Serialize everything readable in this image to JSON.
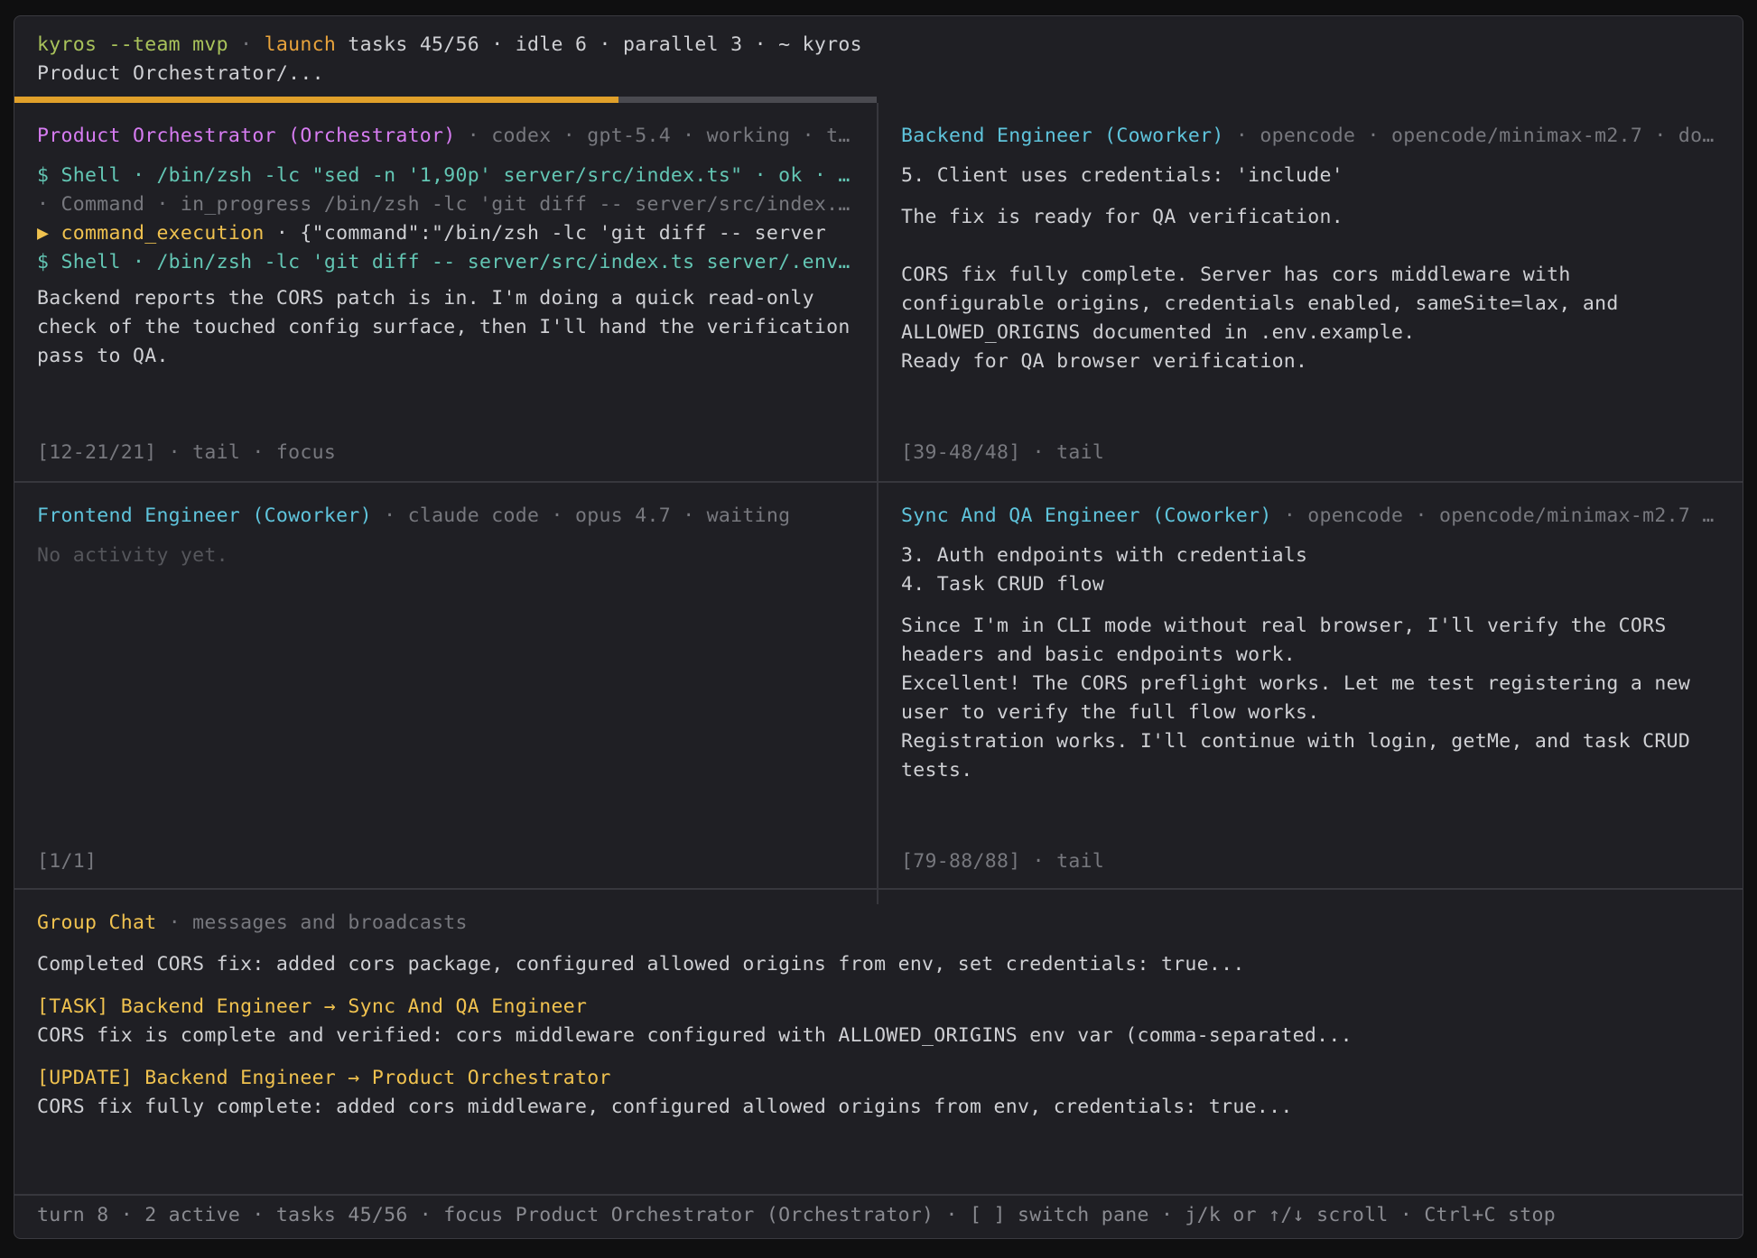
{
  "header": {
    "cmd": "kyros --team mvp",
    "sep": " · ",
    "action": "launch",
    "rest": " tasks 45/56 · idle 6 · parallel 3 · ~ kyros",
    "subtitle": "Product Orchestrator/..."
  },
  "progress": {
    "fraction": 0.7,
    "fill_color": "#e0a02a"
  },
  "panes": {
    "orchestrator": {
      "title": "Product Orchestrator (Orchestrator)",
      "meta": " · codex · gpt-5.4 · working · t…",
      "line1": "$ Shell · /bin/zsh -lc \"sed -n '1,90p' server/src/index.ts\" · ok · …",
      "line2": "· Command · in_progress /bin/zsh -lc 'git diff -- server/src/index.…",
      "line3_label": "▶ command_execution",
      "line3_rest": " · {\"command\":\"/bin/zsh -lc 'git diff -- server",
      "line4": "$ Shell · /bin/zsh -lc 'git diff -- server/src/index.ts server/.env…",
      "body": "Backend reports the CORS patch is in. I'm doing a quick read-only\ncheck of the touched config surface, then I'll hand the verification\npass to QA.",
      "footer": "[12-21/21] · tail · focus"
    },
    "backend": {
      "title": "Backend Engineer (Coworker)",
      "meta": " · opencode · opencode/minimax-m2.7 · do…",
      "line1": "5. Client uses credentials: 'include'",
      "line2": "The fix is ready for QA verification.",
      "body": "CORS fix fully complete. Server has cors middleware with\nconfigurable origins, credentials enabled, sameSite=lax, and\nALLOWED_ORIGINS documented in .env.example.\nReady for QA browser verification.",
      "footer": "[39-48/48] · tail"
    },
    "frontend": {
      "title": "Frontend Engineer (Coworker)",
      "meta": " · claude code · opus 4.7 · waiting",
      "empty": "No activity yet.",
      "footer": "[1/1]"
    },
    "qa": {
      "title": "Sync And QA Engineer (Coworker)",
      "meta": " · opencode · opencode/minimax-m2.7 …",
      "list": "3. Auth endpoints with credentials\n4. Task CRUD flow",
      "body": "Since I'm in CLI mode without real browser, I'll verify the CORS\nheaders and basic endpoints work.\nExcellent! The CORS preflight works. Let me test registering a new\nuser to verify the full flow works.\nRegistration works. I'll continue with login, getMe, and task CRUD\ntests.",
      "footer": "[79-88/88] · tail"
    }
  },
  "chat": {
    "title": "Group Chat",
    "subtitle": " · messages and broadcasts",
    "msg1": "Completed CORS fix: added cors package, configured allowed origins from env, set credentials: true...",
    "msg2_head": "[TASK] Backend Engineer → Sync And QA Engineer",
    "msg2_body": "CORS fix is complete and verified: cors middleware configured with ALLOWED_ORIGINS env var (comma-separated...",
    "msg3_head": "[UPDATE] Backend Engineer → Product Orchestrator",
    "msg3_body": "CORS fix fully complete: added cors middleware, configured allowed origins from env, credentials: true..."
  },
  "statusbar": "turn 8 · 2 active · tasks 45/56 · focus Product Orchestrator (Orchestrator) · [ ] switch pane · j/k or ↑/↓ scroll · Ctrl+C stop"
}
